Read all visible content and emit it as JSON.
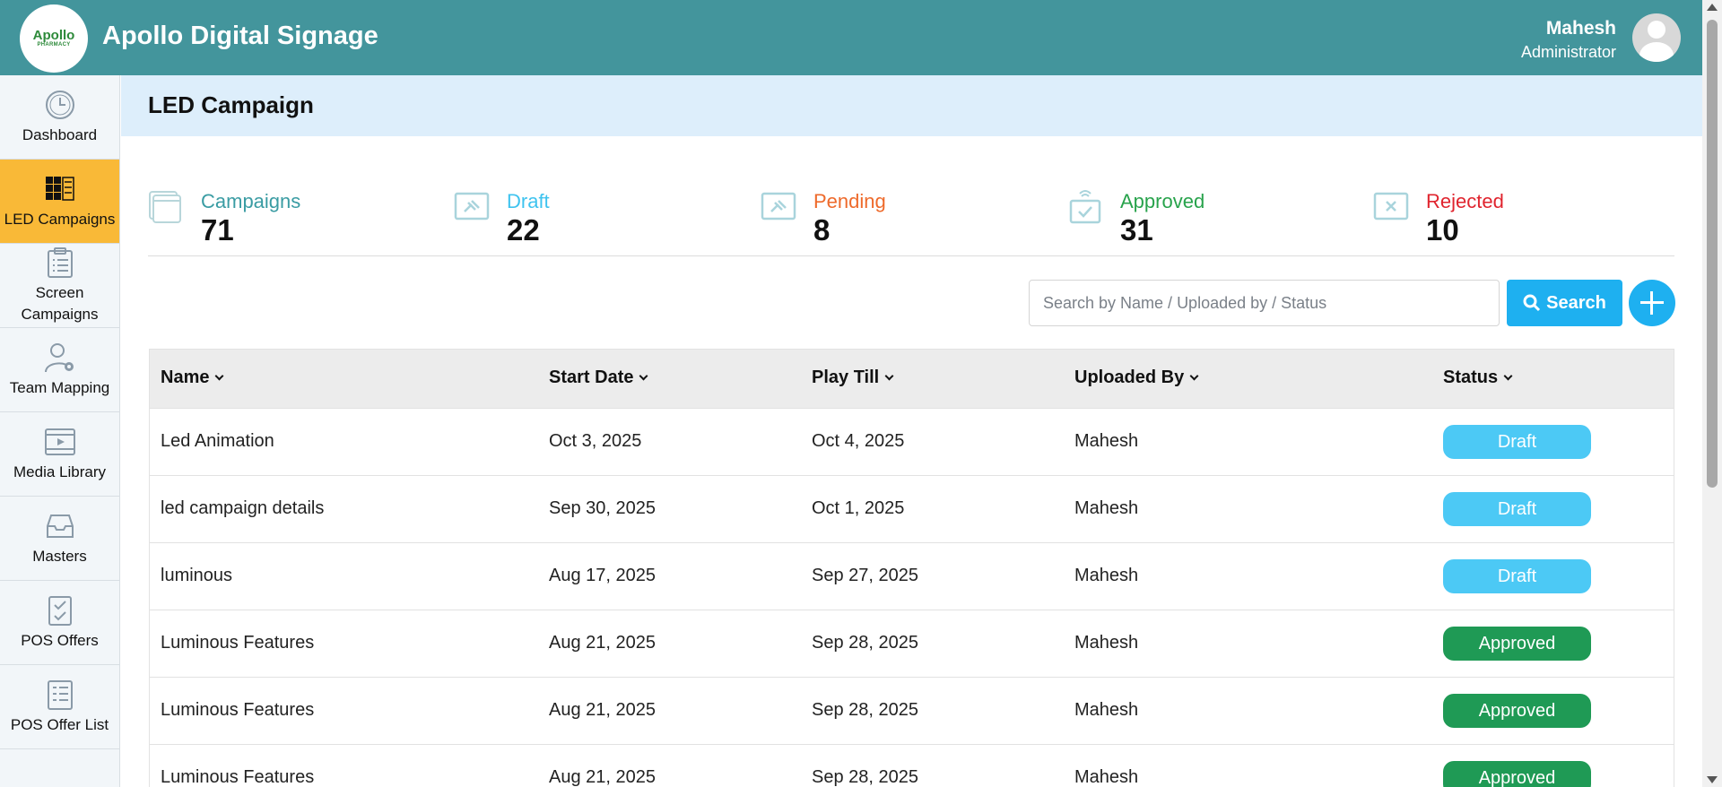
{
  "header": {
    "logo_line1": "Apollo",
    "logo_line2": "PHARMACY",
    "title": "Apollo Digital Signage",
    "user_name": "Mahesh",
    "user_role": "Administrator"
  },
  "sidebar": {
    "items": [
      {
        "label": "Dashboard",
        "icon": "clock-icon",
        "active": false
      },
      {
        "label": "LED Campaigns",
        "icon": "led-grid-icon",
        "active": true
      },
      {
        "label": "Screen Campaigns",
        "icon": "clipboard-icon",
        "active": false
      },
      {
        "label": "Team Mapping",
        "icon": "user-gear-icon",
        "active": false
      },
      {
        "label": "Media Library",
        "icon": "video-icon",
        "active": false
      },
      {
        "label": "Masters",
        "icon": "inbox-icon",
        "active": false
      },
      {
        "label": "POS Offers",
        "icon": "checklist-icon",
        "active": false
      },
      {
        "label": "POS Offer List",
        "icon": "list-icon",
        "active": false
      }
    ]
  },
  "page": {
    "title": "LED Campaign"
  },
  "stats": [
    {
      "label": "Campaigns",
      "value": "71",
      "color": "#3a9ca3",
      "icon": "windows-icon"
    },
    {
      "label": "Draft",
      "value": "22",
      "color": "#3ec3ef",
      "icon": "draft-screen-icon"
    },
    {
      "label": "Pending",
      "value": "8",
      "color": "#ee6a2b",
      "icon": "pending-screen-icon"
    },
    {
      "label": "Approved",
      "value": "31",
      "color": "#28a34c",
      "icon": "approved-screen-icon"
    },
    {
      "label": "Rejected",
      "value": "10",
      "color": "#e0242e",
      "icon": "rejected-screen-icon"
    }
  ],
  "search": {
    "placeholder": "Search by Name / Uploaded by / Status",
    "button_label": "Search"
  },
  "table": {
    "columns": [
      "Name",
      "Start Date",
      "Play Till",
      "Uploaded By",
      "Status"
    ],
    "rows": [
      {
        "name": "Led Animation",
        "start": "Oct 3, 2025",
        "play_till": "Oct 4, 2025",
        "uploaded_by": "Mahesh",
        "status": "Draft"
      },
      {
        "name": "led campaign details",
        "start": "Sep 30, 2025",
        "play_till": "Oct 1, 2025",
        "uploaded_by": "Mahesh",
        "status": "Draft"
      },
      {
        "name": "luminous",
        "start": "Aug 17, 2025",
        "play_till": "Sep 27, 2025",
        "uploaded_by": "Mahesh",
        "status": "Draft"
      },
      {
        "name": "Luminous Features",
        "start": "Aug 21, 2025",
        "play_till": "Sep 28, 2025",
        "uploaded_by": "Mahesh",
        "status": "Approved"
      },
      {
        "name": "Luminous Features",
        "start": "Aug 21, 2025",
        "play_till": "Sep 28, 2025",
        "uploaded_by": "Mahesh",
        "status": "Approved"
      },
      {
        "name": "Luminous Features",
        "start": "Aug 21, 2025",
        "play_till": "Sep 28, 2025",
        "uploaded_by": "Mahesh",
        "status": "Approved"
      }
    ]
  }
}
